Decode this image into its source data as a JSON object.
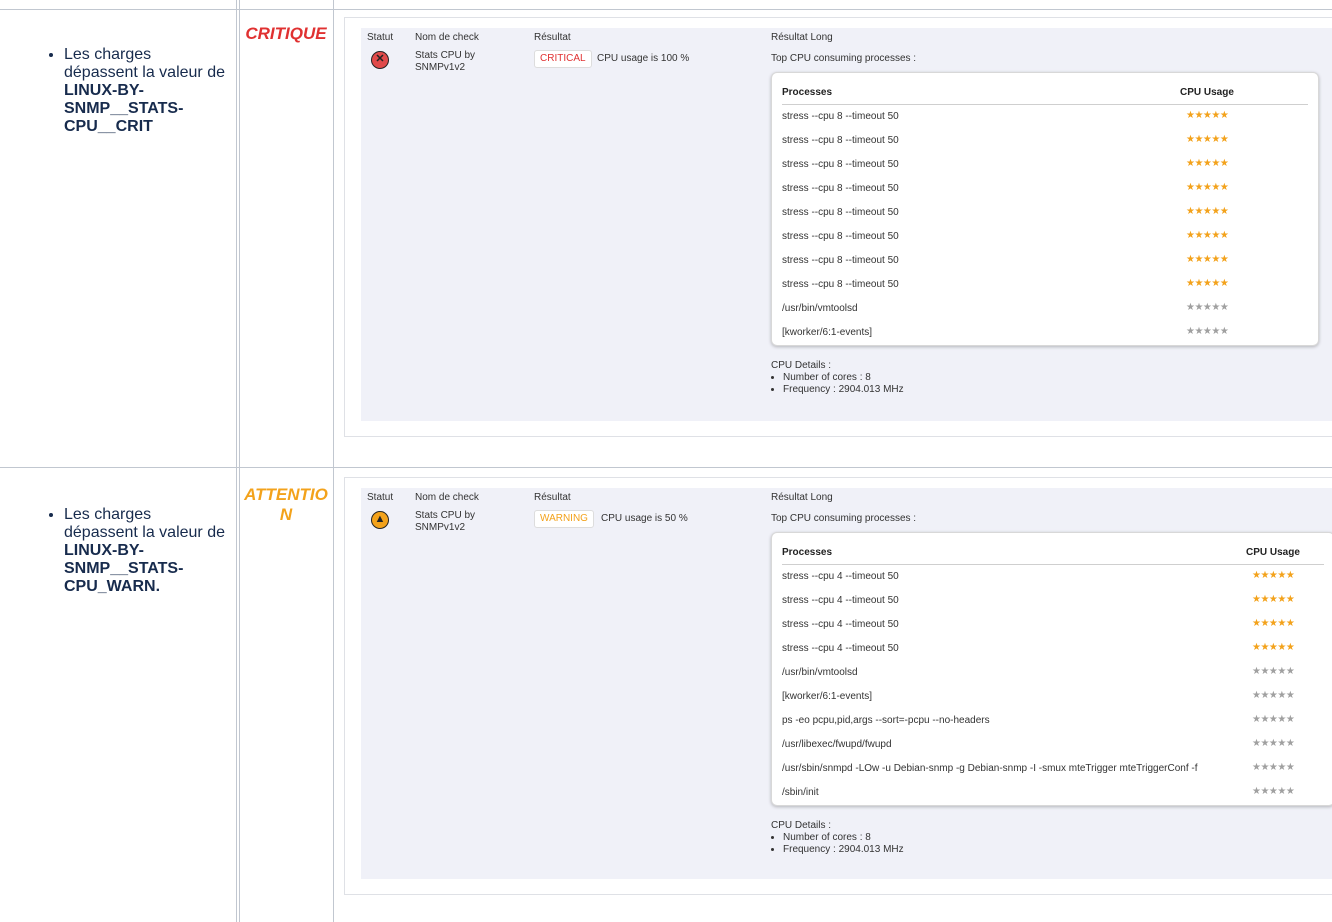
{
  "colors": {
    "critical": "#e03131",
    "warning": "#f3a21b",
    "star_on": "#f3a21b",
    "star_off": "#a0a0a0"
  },
  "rows": [
    {
      "level": "CRITIQUE",
      "desc_prefix": "Les charges dépassent la valeur de ",
      "desc_bold": "LINUX-BY-SNMP__STATS-CPU__CRIT",
      "desc_suffix": "",
      "panel": {
        "headers": {
          "status": "Statut",
          "check": "Nom de check",
          "result": "Résultat",
          "long": "Résultat Long"
        },
        "status_icon": "critical-x-icon",
        "check_name": "Stats CPU by SNMPv1v2",
        "badge": "CRITICAL",
        "result_text": "CPU usage is 100 %",
        "top_title": "Top CPU consuming processes :",
        "col_processes": "Processes",
        "col_usage": "CPU Usage",
        "processes": [
          {
            "name": "stress --cpu 8 --timeout 50",
            "stars": "★★★★★",
            "hot": true
          },
          {
            "name": "stress --cpu 8 --timeout 50",
            "stars": "★★★★★",
            "hot": true
          },
          {
            "name": "stress --cpu 8 --timeout 50",
            "stars": "★★★★★",
            "hot": true
          },
          {
            "name": "stress --cpu 8 --timeout 50",
            "stars": "★★★★★",
            "hot": true
          },
          {
            "name": "stress --cpu 8 --timeout 50",
            "stars": "★★★★★",
            "hot": true
          },
          {
            "name": "stress --cpu 8 --timeout 50",
            "stars": "★★★★★",
            "hot": true
          },
          {
            "name": "stress --cpu 8 --timeout 50",
            "stars": "★★★★★",
            "hot": true
          },
          {
            "name": "stress --cpu 8 --timeout 50",
            "stars": "★★★★★",
            "hot": true
          },
          {
            "name": "/usr/bin/vmtoolsd",
            "stars": "★★★★★",
            "hot": false
          },
          {
            "name": "[kworker/6:1-events]",
            "stars": "★★★★★",
            "hot": false
          }
        ],
        "details_title": "CPU Details :",
        "cores": "Number of cores : 8",
        "frequency": "Frequency : 2904.013 MHz"
      }
    },
    {
      "level": "ATTENTION",
      "desc_prefix": "Les charges dépassent la valeur de ",
      "desc_bold": "LINUX-BY-SNMP__STATS-CPU_WARN.",
      "desc_suffix": "",
      "panel": {
        "headers": {
          "status": "Statut",
          "check": "Nom de check",
          "result": "Résultat",
          "long": "Résultat Long"
        },
        "status_icon": "warning-triangle-icon",
        "check_name": "Stats CPU by SNMPv1v2",
        "badge": "WARNING",
        "result_text": "CPU usage is 50 %",
        "top_title": "Top CPU consuming processes :",
        "col_processes": "Processes",
        "col_usage": "CPU Usage",
        "processes": [
          {
            "name": "stress --cpu 4 --timeout 50",
            "stars": "★★★★★",
            "hot": true
          },
          {
            "name": "stress --cpu 4 --timeout 50",
            "stars": "★★★★★",
            "hot": true
          },
          {
            "name": "stress --cpu 4 --timeout 50",
            "stars": "★★★★★",
            "hot": true
          },
          {
            "name": "stress --cpu 4 --timeout 50",
            "stars": "★★★★★",
            "hot": true
          },
          {
            "name": "/usr/bin/vmtoolsd",
            "stars": "★★★★★",
            "hot": false
          },
          {
            "name": "[kworker/6:1-events]",
            "stars": "★★★★★",
            "hot": false
          },
          {
            "name": "ps -eo pcpu,pid,args --sort=-pcpu --no-headers",
            "stars": "★★★★★",
            "hot": false
          },
          {
            "name": "/usr/libexec/fwupd/fwupd",
            "stars": "★★★★★",
            "hot": false
          },
          {
            "name": "/usr/sbin/snmpd -LOw -u Debian-snmp -g Debian-snmp -I -smux mteTrigger mteTriggerConf -f",
            "stars": "★★★★★",
            "hot": false
          },
          {
            "name": "/sbin/init",
            "stars": "★★★★★",
            "hot": false
          }
        ],
        "details_title": "CPU Details :",
        "cores": "Number of cores : 8",
        "frequency": "Frequency : 2904.013 MHz"
      }
    }
  ]
}
